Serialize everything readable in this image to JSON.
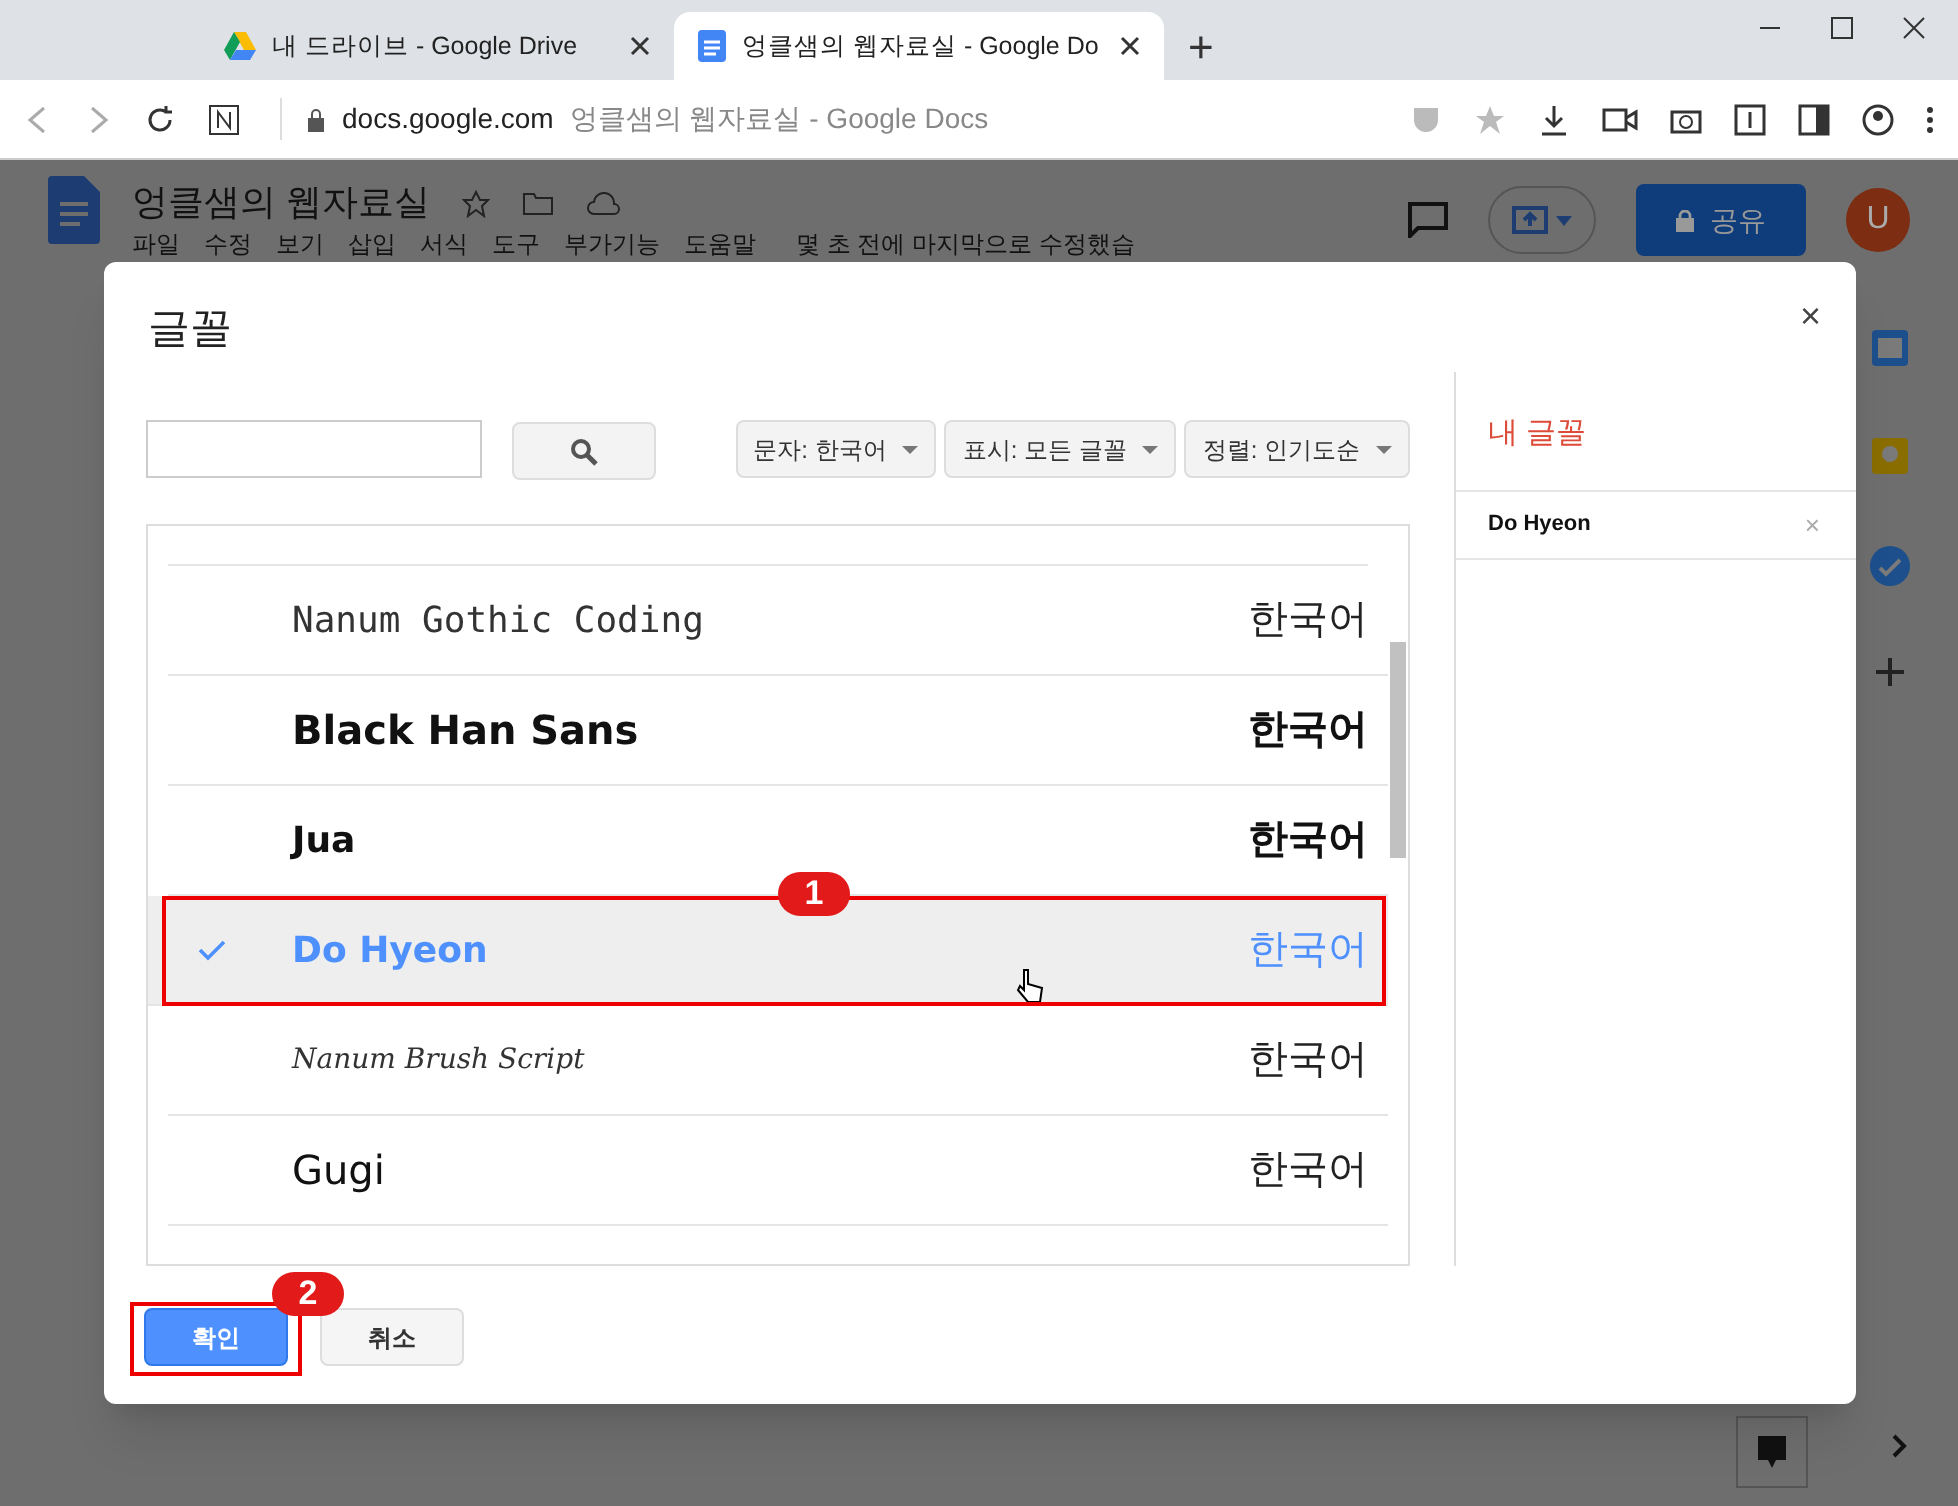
{
  "browser": {
    "tabs": [
      {
        "title": "내 드라이브 - Google Drive",
        "selected": false
      },
      {
        "title": "엉클샘의 웹자료실 - Google Do",
        "selected": true
      }
    ],
    "new_tab": "+",
    "address": {
      "domain": "docs.google.com",
      "page_title": "엉클샘의 웹자료실 - Google Docs"
    }
  },
  "document": {
    "title": "엉클샘의 웹자료실",
    "menu": [
      "파일",
      "수정",
      "보기",
      "삽입",
      "서식",
      "도구",
      "부가기능",
      "도움말"
    ],
    "last_edit": "몇 초 전에 마지막으로 수정했습",
    "share": "공유",
    "avatar": "U"
  },
  "dialog": {
    "title": "글꼴",
    "close": "×",
    "filters": [
      "문자: 한국어",
      "표시: 모든 글꼴",
      "정렬: 인기도순"
    ],
    "fonts": [
      {
        "name": "Nanum Gothic Coding",
        "sample": "한국어",
        "selected": false
      },
      {
        "name": "Black Han Sans",
        "sample": "한국어",
        "selected": false
      },
      {
        "name": "Jua",
        "sample": "한국어",
        "selected": false
      },
      {
        "name": "Do Hyeon",
        "sample": "한국어",
        "selected": true
      },
      {
        "name": "Nanum Brush Script",
        "sample": "한국어",
        "selected": false
      },
      {
        "name": "Gugi",
        "sample": "한국어",
        "selected": false
      }
    ],
    "my_fonts": {
      "title": "내 글꼴",
      "items": [
        {
          "name": "Do Hyeon",
          "remove": "×"
        }
      ]
    },
    "buttons": {
      "ok": "확인",
      "cancel": "취소"
    }
  },
  "annotations": [
    {
      "label": "1"
    },
    {
      "label": "2"
    }
  ]
}
